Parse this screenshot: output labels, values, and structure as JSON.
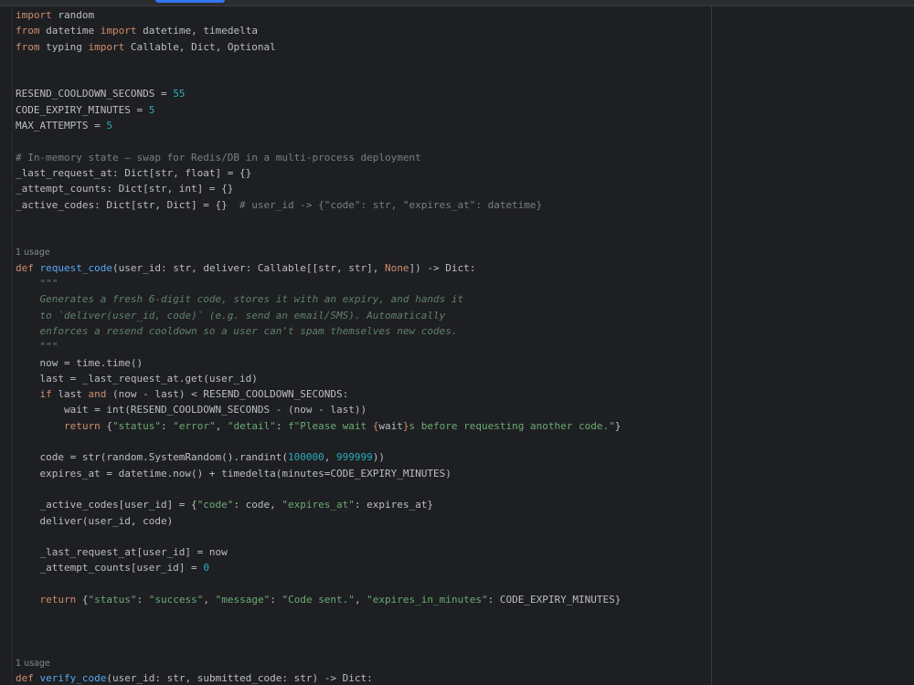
{
  "colors": {
    "background": "#1e1f22",
    "keyword": "#cf8e6d",
    "number": "#2aacb8",
    "string": "#6aab73",
    "docstring": "#5f826b",
    "comment": "#7a7e85",
    "default": "#bcbec4",
    "accent": "#3574f0"
  },
  "editor": {
    "lines": [
      {
        "tokens": [
          {
            "t": "import",
            "c": "kw"
          },
          {
            "t": " random"
          }
        ]
      },
      {
        "tokens": [
          {
            "t": "from",
            "c": "kw"
          },
          {
            "t": " datetime "
          },
          {
            "t": "import",
            "c": "kw"
          },
          {
            "t": " datetime, timedelta"
          }
        ]
      },
      {
        "tokens": [
          {
            "t": "from",
            "c": "kw"
          },
          {
            "t": " typing "
          },
          {
            "t": "import",
            "c": "kw"
          },
          {
            "t": " Callable, Dict, Optional"
          }
        ]
      },
      {
        "tokens": []
      },
      {
        "tokens": []
      },
      {
        "tokens": [
          {
            "t": "RESEND_COOLDOWN_SECONDS = "
          },
          {
            "t": "55",
            "c": "num"
          }
        ]
      },
      {
        "tokens": [
          {
            "t": "CODE_EXPIRY_MINUTES = "
          },
          {
            "t": "5",
            "c": "num"
          }
        ]
      },
      {
        "tokens": [
          {
            "t": "MAX_ATTEMPTS = "
          },
          {
            "t": "5",
            "c": "num"
          }
        ]
      },
      {
        "tokens": []
      },
      {
        "tokens": [
          {
            "t": "# In-memory state — swap for Redis/DB in a multi-process deployment",
            "c": "cm"
          }
        ]
      },
      {
        "tokens": [
          {
            "t": "_last_request_at: Dict[str, float] = {}"
          }
        ]
      },
      {
        "tokens": [
          {
            "t": "_attempt_counts: Dict[str, int] = {}"
          }
        ]
      },
      {
        "tokens": [
          {
            "t": "_active_codes: Dict[str, Dict] = {}  "
          },
          {
            "t": "# user_id -> {\"code\": str, \"expires_at\": datetime}",
            "c": "cm"
          }
        ]
      },
      {
        "tokens": []
      },
      {
        "tokens": []
      },
      {
        "inlay": "1 usage"
      },
      {
        "tokens": [
          {
            "t": "def",
            "c": "kw"
          },
          {
            "t": " "
          },
          {
            "t": "request_code",
            "c": "fn"
          },
          {
            "t": "(user_id: str, deliver: Callable[[str, str], "
          },
          {
            "t": "None",
            "c": "kw"
          },
          {
            "t": "]) -> Dict:"
          }
        ]
      },
      {
        "tokens": [
          {
            "t": "    "
          },
          {
            "t": "\"\"\"",
            "c": "doc"
          }
        ]
      },
      {
        "tokens": [
          {
            "t": "    "
          },
          {
            "t": "Generates a fresh 6-digit code, stores it with an expiry, and hands it",
            "c": "doc"
          }
        ]
      },
      {
        "tokens": [
          {
            "t": "    "
          },
          {
            "t": "to `deliver(user_id, code)` (e.g. send an email/SMS). Automatically",
            "c": "doc"
          }
        ]
      },
      {
        "tokens": [
          {
            "t": "    "
          },
          {
            "t": "enforces a resend cooldown so a user can't spam themselves new codes.",
            "c": "doc"
          }
        ]
      },
      {
        "tokens": [
          {
            "t": "    "
          },
          {
            "t": "\"\"\"",
            "c": "doc"
          }
        ]
      },
      {
        "tokens": [
          {
            "t": "    now = time.time()"
          }
        ]
      },
      {
        "tokens": [
          {
            "t": "    last = _last_request_at.get(user_id)"
          }
        ]
      },
      {
        "tokens": [
          {
            "t": "    "
          },
          {
            "t": "if",
            "c": "kw"
          },
          {
            "t": " last "
          },
          {
            "t": "and",
            "c": "kw"
          },
          {
            "t": " (now - last) < RESEND_COOLDOWN_SECONDS:"
          }
        ]
      },
      {
        "tokens": [
          {
            "t": "        wait = int(RESEND_COOLDOWN_SECONDS - (now - last))"
          }
        ]
      },
      {
        "tokens": [
          {
            "t": "        "
          },
          {
            "t": "return",
            "c": "kw"
          },
          {
            "t": " {"
          },
          {
            "t": "\"status\"",
            "c": "str"
          },
          {
            "t": ": "
          },
          {
            "t": "\"error\"",
            "c": "str"
          },
          {
            "t": ", "
          },
          {
            "t": "\"detail\"",
            "c": "str"
          },
          {
            "t": ": "
          },
          {
            "t": "f\"Please wait ",
            "c": "str"
          },
          {
            "t": "{",
            "c": "kw"
          },
          {
            "t": "wait"
          },
          {
            "t": "}",
            "c": "kw"
          },
          {
            "t": "s before requesting another code.\"",
            "c": "str"
          },
          {
            "t": "}"
          }
        ]
      },
      {
        "tokens": []
      },
      {
        "tokens": [
          {
            "t": "    code = str(random.SystemRandom().randint("
          },
          {
            "t": "100000",
            "c": "num"
          },
          {
            "t": ", "
          },
          {
            "t": "999999",
            "c": "num"
          },
          {
            "t": "))"
          }
        ]
      },
      {
        "tokens": [
          {
            "t": "    expires_at = datetime.now() + timedelta(minutes=CODE_EXPIRY_MINUTES)"
          }
        ]
      },
      {
        "tokens": []
      },
      {
        "tokens": [
          {
            "t": "    _active_codes[user_id] = {"
          },
          {
            "t": "\"code\"",
            "c": "str"
          },
          {
            "t": ": code, "
          },
          {
            "t": "\"expires_at\"",
            "c": "str"
          },
          {
            "t": ": expires_at}"
          }
        ]
      },
      {
        "tokens": [
          {
            "t": "    deliver(user_id, code)"
          }
        ]
      },
      {
        "tokens": []
      },
      {
        "tokens": [
          {
            "t": "    _last_request_at[user_id] = now"
          }
        ]
      },
      {
        "tokens": [
          {
            "t": "    _attempt_counts[user_id] = "
          },
          {
            "t": "0",
            "c": "num"
          }
        ]
      },
      {
        "tokens": []
      },
      {
        "tokens": [
          {
            "t": "    "
          },
          {
            "t": "return",
            "c": "kw"
          },
          {
            "t": " {"
          },
          {
            "t": "\"status\"",
            "c": "str"
          },
          {
            "t": ": "
          },
          {
            "t": "\"success\"",
            "c": "str"
          },
          {
            "t": ", "
          },
          {
            "t": "\"message\"",
            "c": "str"
          },
          {
            "t": ": "
          },
          {
            "t": "\"Code sent.\"",
            "c": "str"
          },
          {
            "t": ", "
          },
          {
            "t": "\"expires_in_minutes\"",
            "c": "str"
          },
          {
            "t": ": CODE_EXPIRY_MINUTES}"
          }
        ]
      },
      {
        "tokens": []
      },
      {
        "tokens": []
      },
      {
        "tokens": []
      },
      {
        "inlay": "1 usage"
      },
      {
        "tokens": [
          {
            "t": "def",
            "c": "kw"
          },
          {
            "t": " "
          },
          {
            "t": "verify_code",
            "c": "fn"
          },
          {
            "t": "(user_id: str, submitted_code: str) -> Dict:"
          }
        ]
      },
      {
        "tokens": [
          {
            "t": "    "
          },
          {
            "t": "\"\"\"",
            "c": "doc"
          }
        ]
      }
    ]
  }
}
